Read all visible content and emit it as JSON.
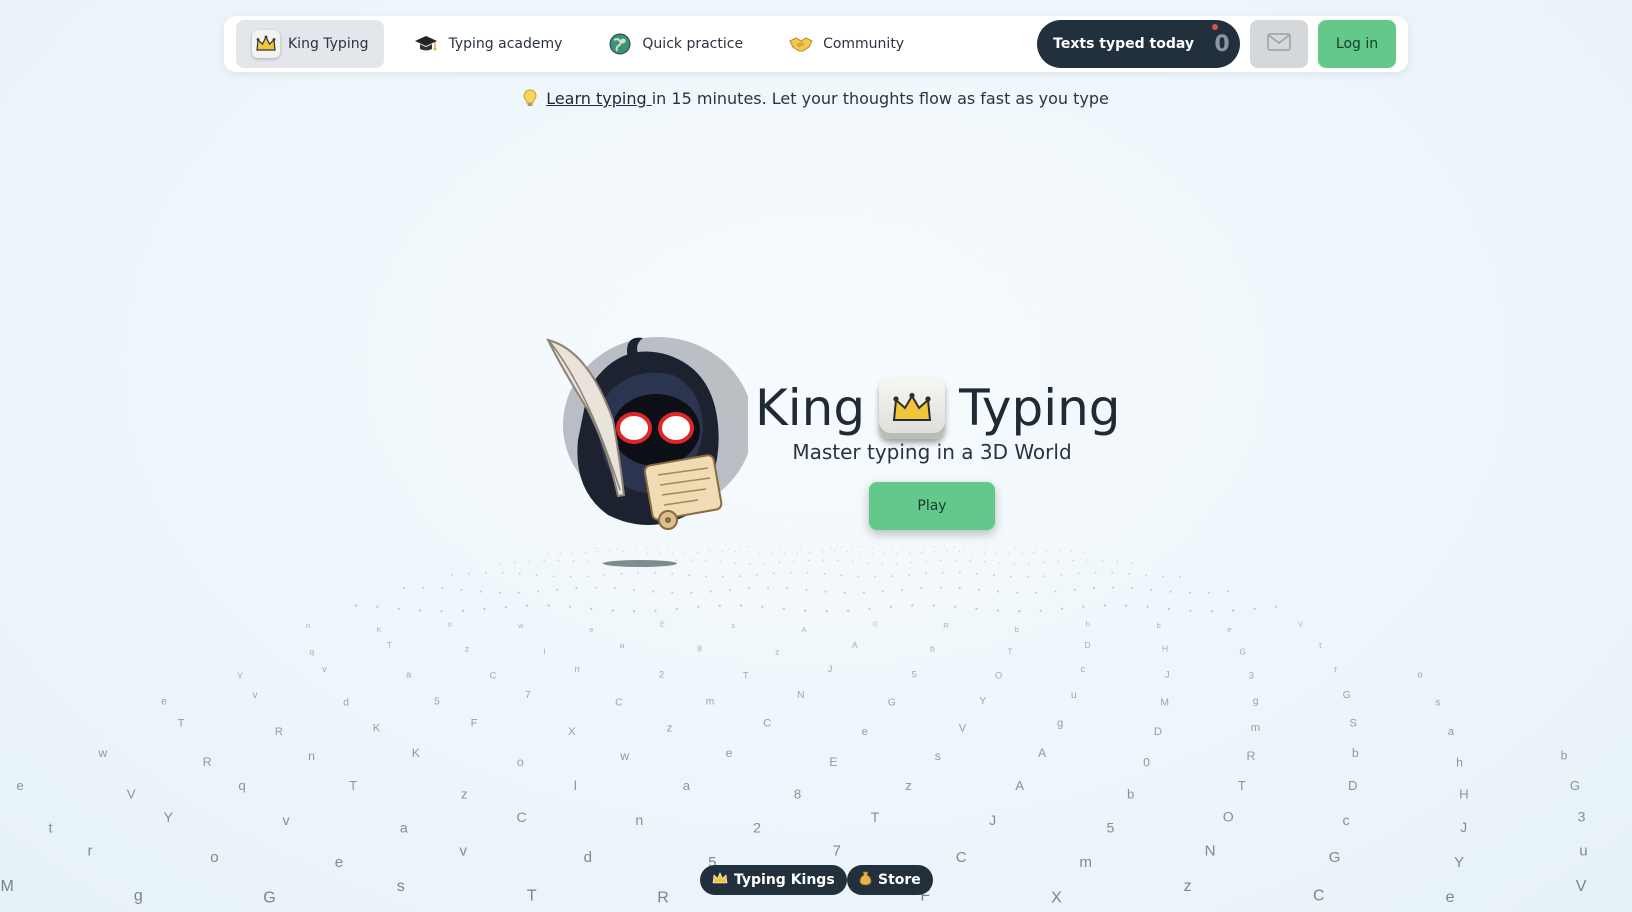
{
  "nav": {
    "items": [
      {
        "label": "King Typing",
        "icon": "crown-icon"
      },
      {
        "label": "Typing academy",
        "icon": "graduation-cap-icon"
      },
      {
        "label": "Quick practice",
        "icon": "globe-icon"
      },
      {
        "label": "Community",
        "icon": "handshake-icon"
      }
    ],
    "texts_typed_label": "Texts typed today",
    "texts_typed_count": "0",
    "login_label": "Log in"
  },
  "tagline": {
    "link": " Learn typing ",
    "rest": "in 15 minutes. Let your thoughts flow as fast as you type"
  },
  "hero": {
    "title_left": "King",
    "title_right": "Typing",
    "subtitle": "Master typing in a 3D World",
    "play_label": "Play"
  },
  "floating_letters": [
    "n",
    "K",
    "o",
    "w",
    "e",
    "E",
    "s",
    "A",
    "0",
    "R",
    "b",
    "h",
    "b",
    "e",
    "V",
    "q",
    "T",
    "z",
    "l",
    "a",
    "8",
    "z",
    "A",
    "b",
    "T",
    "D",
    "H",
    "G",
    "t",
    "Y",
    "v",
    "a",
    "C",
    "n",
    "2",
    "T",
    "J",
    "5",
    "O",
    "c",
    "J",
    "3",
    "r",
    "o",
    "e",
    "v",
    "d",
    "5",
    "7",
    "C",
    "m",
    "N",
    "G",
    "Y",
    "u",
    "M",
    "g",
    "G",
    "s",
    "T",
    "R",
    "K",
    "F",
    "X",
    "z",
    "C",
    "e",
    "V",
    "g",
    "D",
    "m",
    "S",
    "a",
    "w",
    "R"
  ],
  "bottom": {
    "kings_label": "Typing Kings",
    "store_label": "Store"
  },
  "colors": {
    "accent_green": "#62c98a",
    "dark": "#22303d"
  }
}
